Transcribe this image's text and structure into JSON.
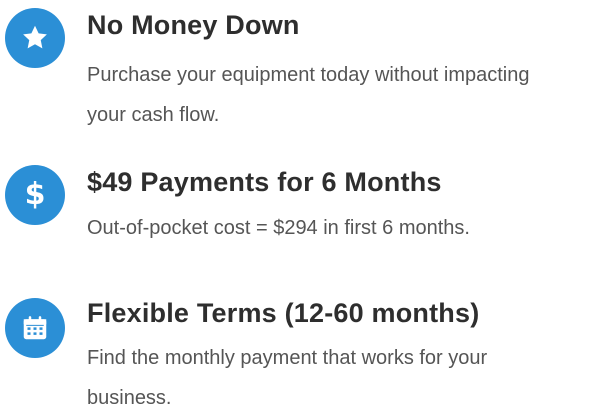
{
  "features": [
    {
      "icon": "star-icon",
      "title": "No Money Down",
      "description": "Purchase your equipment today without impacting your cash flow."
    },
    {
      "icon": "dollar-icon",
      "icon_glyph": "$",
      "title": "$49 Payments for 6 Months",
      "description": "Out-of-pocket cost = $294 in first 6 months."
    },
    {
      "icon": "calendar-icon",
      "title": "Flexible Terms (12-60 months)",
      "description": "Find the monthly payment that works for your business."
    }
  ],
  "colors": {
    "icon_background": "#2b8fd6",
    "icon_foreground": "#ffffff",
    "title_text": "#2e2e2e",
    "description_text": "#555555"
  }
}
